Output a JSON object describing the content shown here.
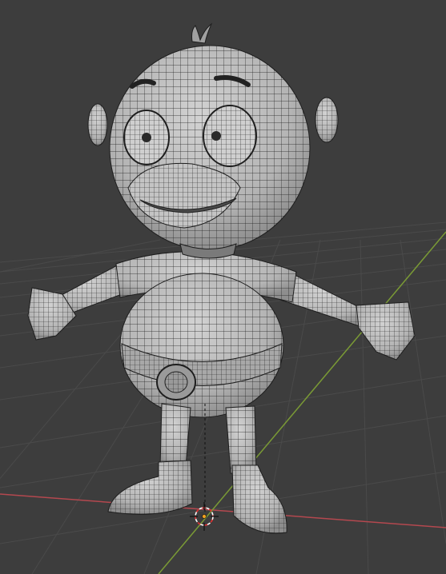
{
  "viewport": {
    "background": "#3d3d3d",
    "grid_color": "#4a4a4a",
    "x_axis_color": "#b4484f",
    "y_axis_color": "#7a9a35",
    "mesh_fill": "#bdbdbd",
    "wire_color": "#222222",
    "cursor_colors": [
      "#ffffff",
      "#e03030"
    ],
    "origin_color": "#f0a020"
  },
  "scene": {
    "object": "cartoon-character-mesh",
    "mode": "wireframe-overlay",
    "icons": [
      "3d-cursor-icon",
      "object-origin-icon"
    ]
  }
}
